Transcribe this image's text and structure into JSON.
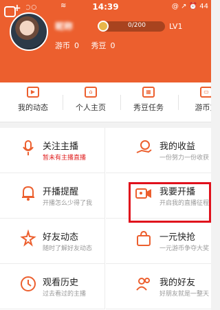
{
  "status_bar": {
    "signal": "●●○○○",
    "carrier": "",
    "time": "14:39",
    "right": "@ ↗ ⏰ 44"
  },
  "profile": {
    "nickname": "昵称",
    "level_progress": "0/200",
    "level_label": "LV1",
    "coin_label": "游币",
    "coin_value": "0",
    "bean_label": "秀豆",
    "bean_value": "0"
  },
  "quick_items": [
    {
      "label": "我的动态",
      "icon": "play-icon"
    },
    {
      "label": "个人主页",
      "icon": "home-icon"
    },
    {
      "label": "秀豆任务",
      "icon": "calendar-icon"
    },
    {
      "label": "游币充",
      "icon": "wallet-icon"
    }
  ],
  "grid": [
    {
      "title": "关注主播",
      "subtitle": "暂未有主播直播",
      "icon": "microphone-icon",
      "subtitle_red": true
    },
    {
      "title": "我的收益",
      "subtitle": "一份努力一份收获",
      "icon": "coin-hand-icon"
    },
    {
      "title": "开播提醒",
      "subtitle": "开播怎么少得了我",
      "icon": "bell-icon"
    },
    {
      "title": "我要开播",
      "subtitle": "开启我的直播征程",
      "icon": "video-camera-icon"
    },
    {
      "title": "好友动态",
      "subtitle": "随时了解好友动态",
      "icon": "star-sparkle-icon"
    },
    {
      "title": "一元快抢",
      "subtitle": "一元游币争夺大奖",
      "icon": "bag-icon"
    },
    {
      "title": "观看历史",
      "subtitle": "过去看过的主播",
      "icon": "clock-icon"
    },
    {
      "title": "我的好友",
      "subtitle": "好朋友就是一整天",
      "icon": "friends-icon"
    }
  ],
  "colors": {
    "accent": "#ec5f2e",
    "highlight": "#e0101c"
  }
}
